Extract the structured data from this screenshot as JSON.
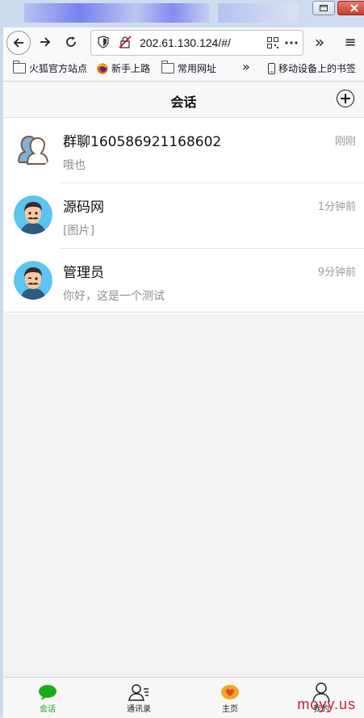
{
  "browser": {
    "url": "202.61.130.124/#/",
    "bookmarks": [
      {
        "label": "火狐官方站点"
      },
      {
        "label": "新手上路"
      },
      {
        "label": "常用网址"
      },
      {
        "label": "移动设备上的书签"
      }
    ],
    "overflow_glyph": "»",
    "menu_glyph": "≡"
  },
  "header": {
    "title": "会话"
  },
  "conversations": [
    {
      "name": "群聊160586921168602",
      "time": "刚刚",
      "preview": "哦也",
      "avatar_icon": "group-avatar-icon"
    },
    {
      "name": "源码网",
      "time": "1分钟前",
      "preview": "[图片]",
      "avatar_icon": "user-avatar-icon"
    },
    {
      "name": "管理员",
      "time": "9分钟前",
      "preview": "你好，这是一个测试",
      "avatar_icon": "user-avatar-icon"
    }
  ],
  "tabbar": {
    "tabs": [
      {
        "label": "会话",
        "icon": "chat-bubble-icon",
        "active": true
      },
      {
        "label": "通讯录",
        "icon": "contacts-icon",
        "active": false
      },
      {
        "label": "主页",
        "icon": "heart-home-icon",
        "active": false
      },
      {
        "label": "我的",
        "icon": "profile-icon",
        "active": false
      }
    ]
  },
  "watermark": "moyy.us",
  "colors": {
    "accent": "#1aad19",
    "watermark": "#c41e3a"
  }
}
